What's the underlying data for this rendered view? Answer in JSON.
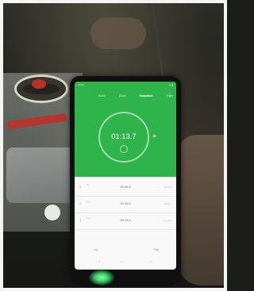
{
  "status_bar": {
    "time": "12:34",
    "signal": "▲ ▮"
  },
  "tabs": [
    {
      "label": "Alarm",
      "active": false
    },
    {
      "label": "Clock",
      "active": false
    },
    {
      "label": "Stopwatch",
      "active": true
    },
    {
      "label": "Timer",
      "active": false
    }
  ],
  "stopwatch": {
    "time": "01:13.7"
  },
  "laps": [
    {
      "num": "3",
      "sub": "Lap",
      "time": "00:46.8",
      "extra": "00:26.9"
    },
    {
      "num": "2",
      "sub": "Lap",
      "time": "00:44.6",
      "extra": "00:24.7"
    },
    {
      "num": "1",
      "sub": "Lap",
      "time": "00:19.8",
      "extra": "00:19.8"
    }
  ],
  "buttons": {
    "left": "Lap",
    "right": "Stop"
  },
  "navbar": {
    "menu": "≡",
    "home": "□",
    "back": "◁"
  },
  "colors": {
    "accent": "#2fb44c",
    "screen_bg": "#f7f8f7"
  }
}
